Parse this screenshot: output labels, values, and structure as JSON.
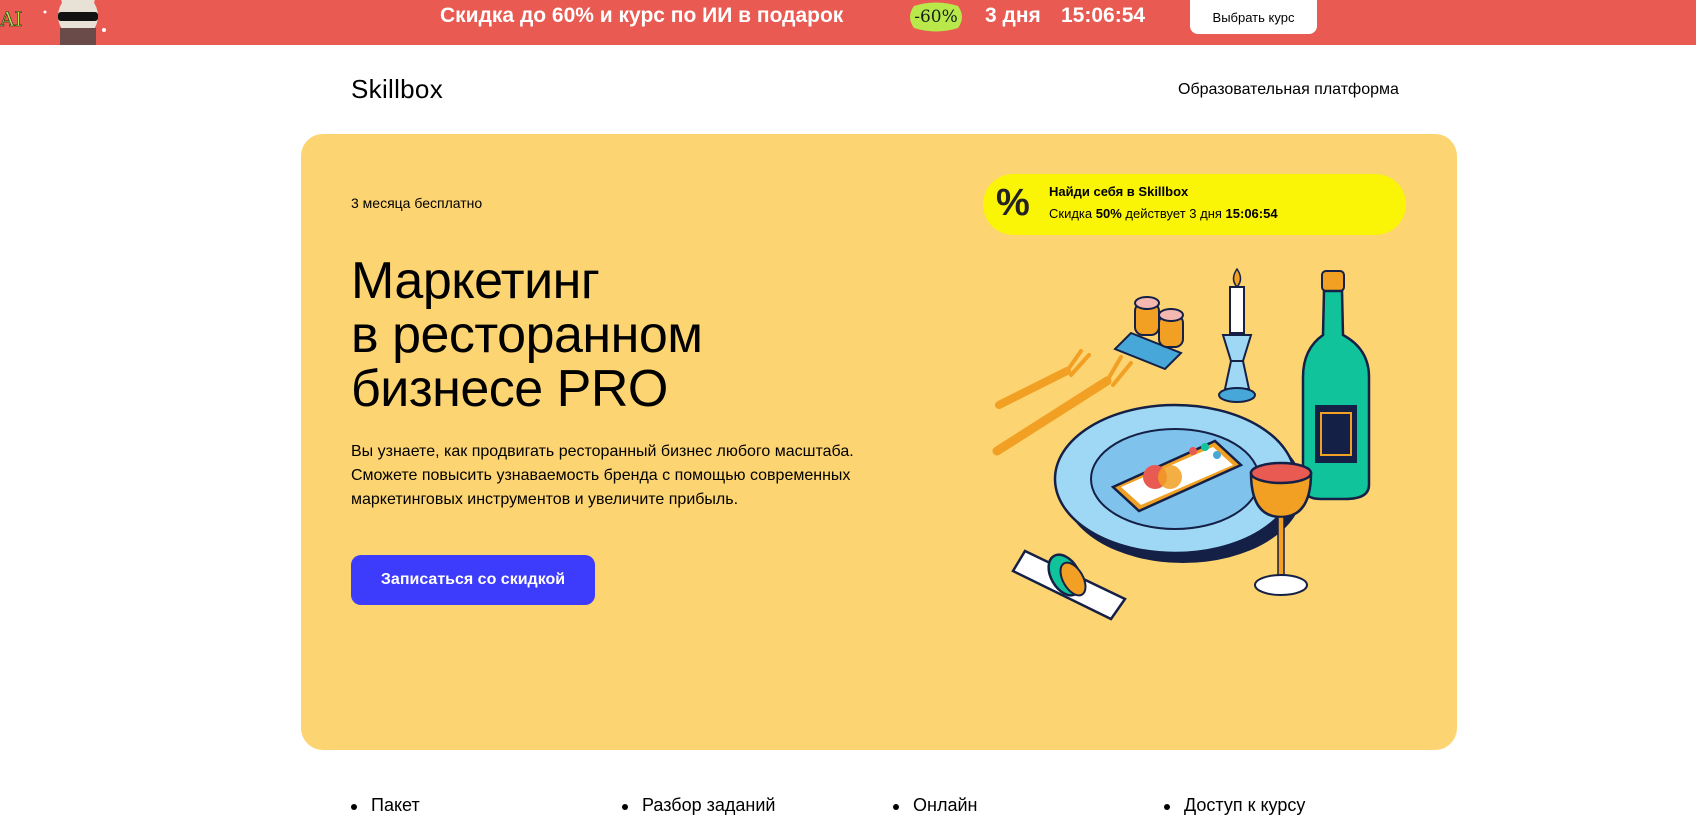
{
  "promo": {
    "text": "Скидка до 60% и курс по ИИ в подарок",
    "badge": "-60%",
    "mascot_label": "AI",
    "days": "3 дня",
    "timer": "15:06:54",
    "button_label": "Выбрать курс",
    "background": "#e85a52",
    "badge_color": "#b8e84a"
  },
  "header": {
    "logo": "Skillbox",
    "nav_link": "Образовательная платформа"
  },
  "hero": {
    "background": "#fdd472",
    "eyebrow": "3 месяца бесплатно",
    "title_lines": [
      "Маркетинг",
      "в ресторанном",
      "бизнесе PRO"
    ],
    "description_lines": [
      "Вы узнаете, как продвигать ресторанный бизнес любого масштаба.",
      "Сможете повысить узнаваемость бренда с помощью современных",
      "маркетинговых инструментов и увеличите прибыль."
    ],
    "cta_label": "Записаться со скидкой",
    "cta_color": "#3d3bfc"
  },
  "discount": {
    "icon": "percent-icon",
    "icon_glyph": "%",
    "title": "Найди себя в Skillbox",
    "line_prefix": "Скидка ",
    "percent": "50%",
    "line_middle": " действует 3 дня ",
    "timer": "15:06:54",
    "background": "#faf406"
  },
  "illustration": {
    "icon": "restaurant-table-illustration"
  },
  "features": [
    "Пакет",
    "Разбор заданий",
    "Онлайн",
    "Доступ к курсу"
  ]
}
